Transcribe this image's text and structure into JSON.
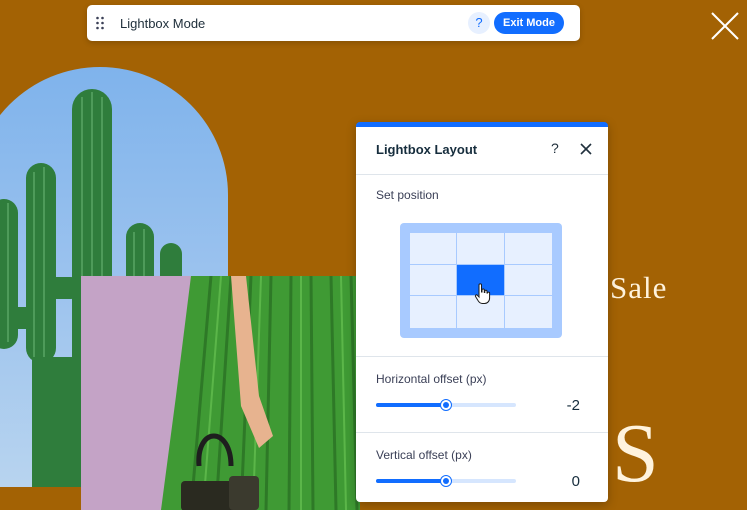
{
  "mode_bar": {
    "title": "Lightbox Mode",
    "help_label": "?",
    "exit_label": "Exit Mode"
  },
  "background_text": {
    "sale": "Sale",
    "large_letter": "S"
  },
  "panel": {
    "title": "Lightbox Layout",
    "help_label": "?",
    "position_section_label": "Set position",
    "selected_position": "center",
    "horizontal_offset": {
      "label": "Horizontal offset (px)",
      "value": "-2",
      "fraction": 0.5
    },
    "vertical_offset": {
      "label": "Vertical offset (px)",
      "value": "0",
      "fraction": 0.5
    }
  },
  "colors": {
    "background": "#a36204",
    "accent": "#116dff",
    "grid_fill": "#e7f0ff",
    "grid_frame": "#a8caff"
  }
}
